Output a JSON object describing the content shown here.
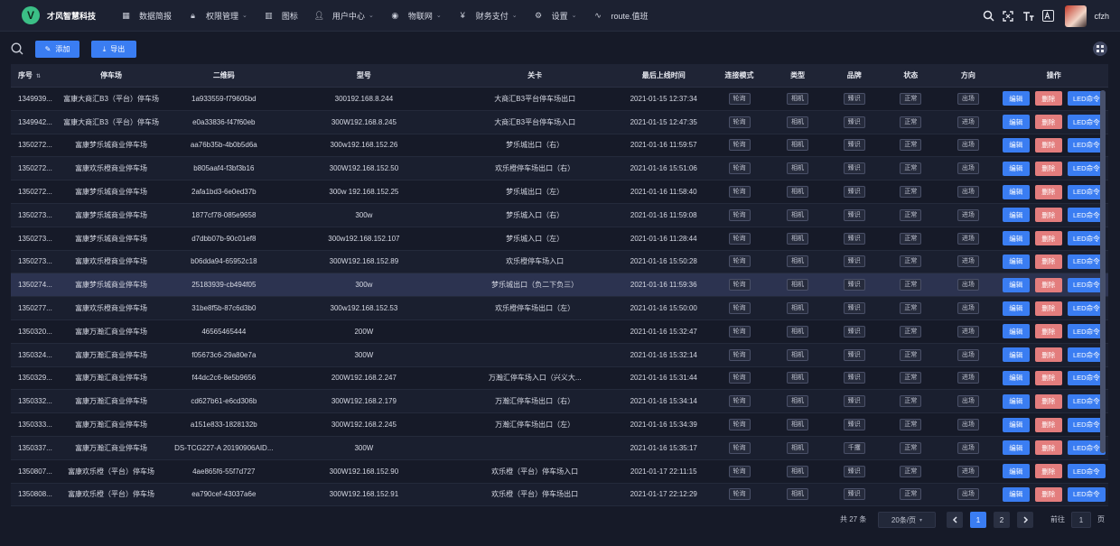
{
  "app": {
    "logo_letter": "V",
    "name": "才风智慧科技"
  },
  "menu": [
    {
      "icon": "dashboard-icon",
      "label": "数据简报",
      "dropdown": false
    },
    {
      "icon": "lock-icon",
      "label": "权限管理",
      "dropdown": true
    },
    {
      "icon": "chart-icon",
      "label": "图标",
      "dropdown": false
    },
    {
      "icon": "user-icon",
      "label": "用户中心",
      "dropdown": true
    },
    {
      "icon": "globe-icon",
      "label": "物联网",
      "dropdown": true
    },
    {
      "icon": "yen-icon",
      "label": "财务支付",
      "dropdown": true
    },
    {
      "icon": "gear-icon",
      "label": "设置",
      "dropdown": true
    },
    {
      "icon": "route-icon",
      "label": "route.值班",
      "dropdown": false
    }
  ],
  "user": {
    "name": "cfzh"
  },
  "toolbar": {
    "add_label": "添加",
    "export_label": "导出"
  },
  "table": {
    "headers": [
      "序号",
      "停车场",
      "二维码",
      "型号",
      "关卡",
      "最后上线时间",
      "连接模式",
      "类型",
      "品牌",
      "状态",
      "方向",
      "操作"
    ],
    "action_labels": {
      "edit": "编辑",
      "delete": "删除",
      "led": "LED命令"
    },
    "highlighted_row": 8,
    "rows": [
      {
        "id": "1349939...",
        "park": "富康大商汇B3（平台）停车场",
        "qr": "1a933559-f79605bd",
        "model": "300192.168.8.244",
        "gate": "大商汇B3平台停车场出口",
        "time": "2021-01-15 12:37:34",
        "conn": "轮询",
        "type": "相机",
        "brand": "臻识",
        "status": "正常",
        "dir": "出场"
      },
      {
        "id": "1349942...",
        "park": "富康大商汇B3（平台）停车场",
        "qr": "e0a33836-f47f60eb",
        "model": "300W192.168.8.245",
        "gate": "大商汇B3平台停车场入口",
        "time": "2021-01-15 12:47:35",
        "conn": "轮询",
        "type": "相机",
        "brand": "臻识",
        "status": "正常",
        "dir": "进场"
      },
      {
        "id": "1350272...",
        "park": "富康梦乐城商业停车场",
        "qr": "aa76b35b-4b0b5d6a",
        "model": "300w192.168.152.26",
        "gate": "梦乐城出口（右）",
        "time": "2021-01-16 11:59:57",
        "conn": "轮询",
        "type": "相机",
        "brand": "臻识",
        "status": "正常",
        "dir": "出场"
      },
      {
        "id": "1350272...",
        "park": "富康欢乐橙商业停车场",
        "qr": "b805aaf4-f3bf3b16",
        "model": "300W192.168.152.50",
        "gate": "欢乐橙停车场出口（右）",
        "time": "2021-01-16 15:51:06",
        "conn": "轮询",
        "type": "相机",
        "brand": "臻识",
        "status": "正常",
        "dir": "出场"
      },
      {
        "id": "1350272...",
        "park": "富康梦乐城商业停车场",
        "qr": "2afa1bd3-6e0ed37b",
        "model": "300w 192.168.152.25",
        "gate": "梦乐城出口（左）",
        "time": "2021-01-16 11:58:40",
        "conn": "轮询",
        "type": "相机",
        "brand": "臻识",
        "status": "正常",
        "dir": "出场"
      },
      {
        "id": "1350273...",
        "park": "富康梦乐城商业停车场",
        "qr": "1877cf78-085e9658",
        "model": "300w",
        "gate": "梦乐城入口（右）",
        "time": "2021-01-16 11:59:08",
        "conn": "轮询",
        "type": "相机",
        "brand": "臻识",
        "status": "正常",
        "dir": "进场"
      },
      {
        "id": "1350273...",
        "park": "富康梦乐城商业停车场",
        "qr": "d7dbb07b-90c01ef8",
        "model": "300w192.168.152.107",
        "gate": "梦乐城入口（左）",
        "time": "2021-01-16 11:28:44",
        "conn": "轮询",
        "type": "相机",
        "brand": "臻识",
        "status": "正常",
        "dir": "进场"
      },
      {
        "id": "1350273...",
        "park": "富康欢乐橙商业停车场",
        "qr": "b06dda94-65952c18",
        "model": "300W192.168.152.89",
        "gate": "欢乐橙停车场入口",
        "time": "2021-01-16 15:50:28",
        "conn": "轮询",
        "type": "相机",
        "brand": "臻识",
        "status": "正常",
        "dir": "进场"
      },
      {
        "id": "1350274...",
        "park": "富康梦乐城商业停车场",
        "qr": "25183939-cb494f05",
        "model": "300w",
        "gate": "梦乐城出口（负二下负三）",
        "time": "2021-01-16 11:59:36",
        "conn": "轮询",
        "type": "相机",
        "brand": "臻识",
        "status": "正常",
        "dir": "出场"
      },
      {
        "id": "1350277...",
        "park": "富康欢乐橙商业停车场",
        "qr": "31be8f5b-87c6d3b0",
        "model": "300w192.168.152.53",
        "gate": "欢乐橙停车场出口（左）",
        "time": "2021-01-16 15:50:00",
        "conn": "轮询",
        "type": "相机",
        "brand": "臻识",
        "status": "正常",
        "dir": "出场"
      },
      {
        "id": "1350320...",
        "park": "富康万瀚汇商业停车场",
        "qr": "46565465444",
        "model": "200W",
        "gate": "",
        "time": "2021-01-16 15:32:47",
        "conn": "轮询",
        "type": "相机",
        "brand": "臻识",
        "status": "正常",
        "dir": "进场"
      },
      {
        "id": "1350324...",
        "park": "富康万瀚汇商业停车场",
        "qr": "f05673c6-29a80e7a",
        "model": "300W",
        "gate": "",
        "time": "2021-01-16 15:32:14",
        "conn": "轮询",
        "type": "相机",
        "brand": "臻识",
        "status": "正常",
        "dir": "出场"
      },
      {
        "id": "1350329...",
        "park": "富康万瀚汇商业停车场",
        "qr": "f44dc2c6-8e5b9656",
        "model": "200W192.168.2.247",
        "gate": "万瀚汇停车场入口（兴义大...",
        "time": "2021-01-16 15:31:44",
        "conn": "轮询",
        "type": "相机",
        "brand": "臻识",
        "status": "正常",
        "dir": "进场"
      },
      {
        "id": "1350332...",
        "park": "富康万瀚汇商业停车场",
        "qr": "cd627b61-e6cd306b",
        "model": "300W192.168.2.179",
        "gate": "万瀚汇停车场出口（右）",
        "time": "2021-01-16 15:34:14",
        "conn": "轮询",
        "type": "相机",
        "brand": "臻识",
        "status": "正常",
        "dir": "出场"
      },
      {
        "id": "1350333...",
        "park": "富康万瀚汇商业停车场",
        "qr": "a151e833-1828132b",
        "model": "300W192.168.2.245",
        "gate": "万瀚汇停车场出口（左）",
        "time": "2021-01-16 15:34:39",
        "conn": "轮询",
        "type": "相机",
        "brand": "臻识",
        "status": "正常",
        "dir": "出场"
      },
      {
        "id": "1350337...",
        "park": "富康万瀚汇商业停车场",
        "qr": "DS-TCG227-A 20190906AID...",
        "model": "300W",
        "gate": "",
        "time": "2021-01-16 15:35:17",
        "conn": "轮询",
        "type": "相机",
        "brand": "千攫",
        "status": "正常",
        "dir": "出场"
      },
      {
        "id": "1350807...",
        "park": "富康欢乐橙（平台）停车场",
        "qr": "4ae865f6-55f7d727",
        "model": "300W192.168.152.90",
        "gate": "欢乐橙（平台）停车场入口",
        "time": "2021-01-17 22:11:15",
        "conn": "轮询",
        "type": "相机",
        "brand": "臻识",
        "status": "正常",
        "dir": "进场"
      },
      {
        "id": "1350808...",
        "park": "富康欢乐橙（平台）停车场",
        "qr": "ea790cef-43037a6e",
        "model": "300W192.168.152.91",
        "gate": "欢乐橙（平台）停车场出口",
        "time": "2021-01-17 22:12:29",
        "conn": "轮询",
        "type": "相机",
        "brand": "臻识",
        "status": "正常",
        "dir": "出场"
      }
    ]
  },
  "pagination": {
    "total": "共 27 条",
    "page_size": "20条/页",
    "pages": [
      "1",
      "2"
    ],
    "current": "1",
    "goto_label": "前往",
    "goto_value": "1",
    "page_suffix": "页"
  },
  "colors": {
    "primary": "#3a7df2",
    "danger": "#e37d7d",
    "background": "#161a28",
    "logo": "#3bbf86"
  }
}
